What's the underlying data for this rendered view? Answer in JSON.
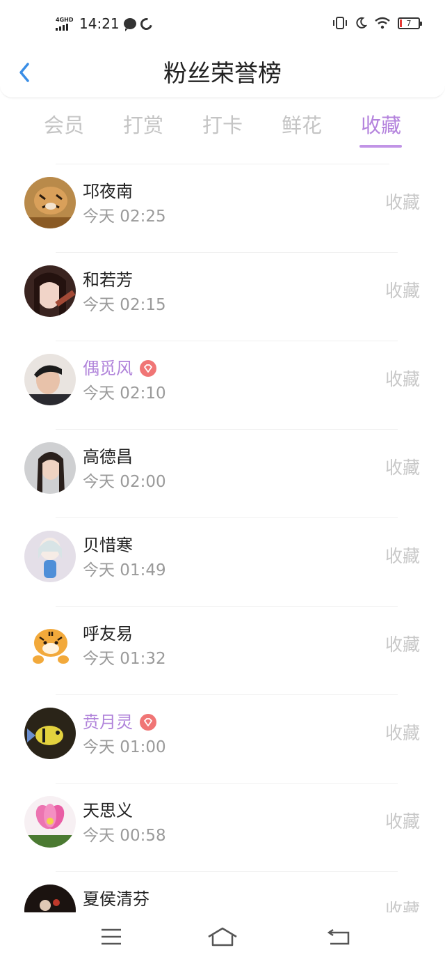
{
  "status_bar": {
    "network": "4GHD",
    "time": "14:21",
    "battery": "7"
  },
  "header": {
    "title": "粉丝荣誉榜"
  },
  "tabs": [
    {
      "label": "会员"
    },
    {
      "label": "打赏"
    },
    {
      "label": "打卡"
    },
    {
      "label": "鲜花"
    },
    {
      "label": "收藏"
    }
  ],
  "active_tab": "收藏",
  "fans": [
    {
      "name": "邛夜南",
      "day": "今天",
      "time": "02:25",
      "time_text": "今天  02:25",
      "action": "收藏",
      "vip": false,
      "avatar": "tiger-photo-avatar"
    },
    {
      "name": "和若芳",
      "day": "今天",
      "time": "02:15",
      "time_text": "今天  02:15",
      "action": "收藏",
      "vip": false,
      "avatar": "girl-photo-avatar"
    },
    {
      "name": "偶觅风",
      "day": "今天",
      "time": "02:10",
      "time_text": "今天  02:10",
      "action": "收藏",
      "vip": true,
      "avatar": "man-photo-avatar"
    },
    {
      "name": "高德昌",
      "day": "今天",
      "time": "02:00",
      "time_text": "今天  02:00",
      "action": "收藏",
      "vip": false,
      "avatar": "woman-photo-avatar"
    },
    {
      "name": "贝惜寒",
      "day": "今天",
      "time": "01:49",
      "time_text": "今天  01:49",
      "action": "收藏",
      "vip": false,
      "avatar": "anime-girl-avatar"
    },
    {
      "name": "呼友易",
      "day": "今天",
      "time": "01:32",
      "time_text": "今天  01:32",
      "action": "收藏",
      "vip": false,
      "avatar": "cartoon-tiger-avatar"
    },
    {
      "name": "贲月灵",
      "day": "今天",
      "time": "01:00",
      "time_text": "今天  01:00",
      "action": "收藏",
      "vip": true,
      "avatar": "fish-photo-avatar"
    },
    {
      "name": "天思义",
      "day": "今天",
      "time": "00:58",
      "time_text": "今天  00:58",
      "action": "收藏",
      "vip": false,
      "avatar": "lotus-flower-avatar"
    },
    {
      "name": "夏侯清芬",
      "day": "",
      "time": "",
      "time_text": "",
      "action": "收藏",
      "vip": false,
      "avatar": "dark-photo-avatar"
    }
  ],
  "colors": {
    "accent": "#b483dd",
    "vip_badge": "#f07575",
    "back_arrow": "#3a8ee6",
    "muted": "#c8c8c8"
  },
  "nav_bar": {
    "icons": [
      "menu-icon",
      "home-icon",
      "back-icon"
    ]
  }
}
